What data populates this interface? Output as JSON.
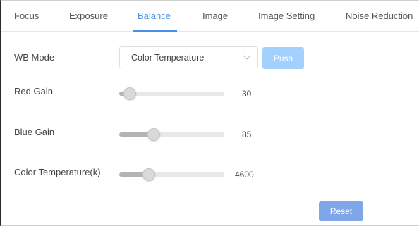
{
  "tabs": [
    {
      "label": "Focus",
      "active": false
    },
    {
      "label": "Exposure",
      "active": false
    },
    {
      "label": "Balance",
      "active": true
    },
    {
      "label": "Image",
      "active": false
    },
    {
      "label": "Image Setting",
      "active": false
    },
    {
      "label": "Noise Reduction",
      "active": false
    }
  ],
  "wb_mode": {
    "label": "WB Mode",
    "selected": "Color Temperature",
    "push_label": "Push"
  },
  "sliders": [
    {
      "label": "Red Gain",
      "value": "30",
      "level": 0.1
    },
    {
      "label": "Blue Gain",
      "value": "85",
      "level": 0.33
    },
    {
      "label": "Color Temperature(k)",
      "value": "4600",
      "level": 0.28
    }
  ],
  "reset_label": "Reset",
  "colors": {
    "accent": "#4a90e2",
    "push_button": "#a3d0fd",
    "reset_button": "#7fa7e8"
  }
}
